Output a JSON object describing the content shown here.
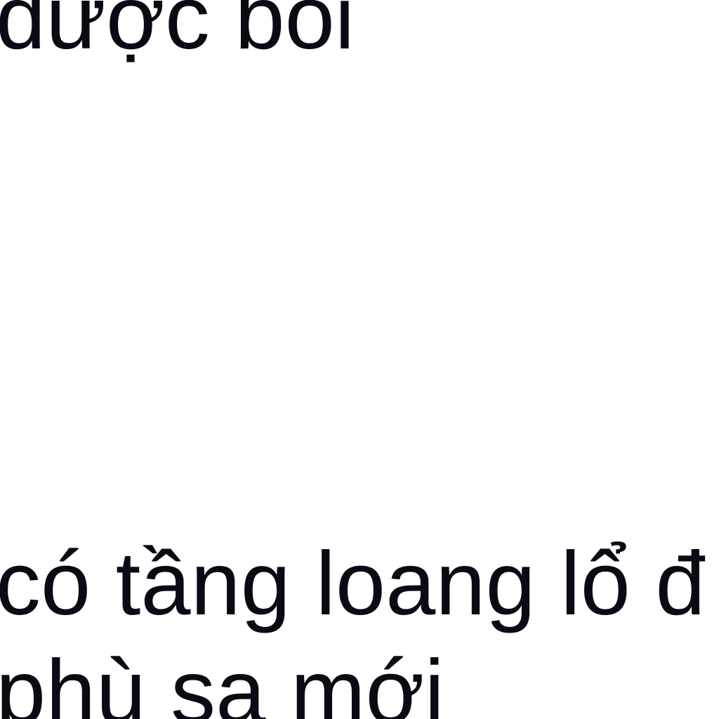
{
  "document": {
    "lines": [
      "được bồi",
      "có tầng loang lổ đ",
      "phù sa mới"
    ]
  }
}
